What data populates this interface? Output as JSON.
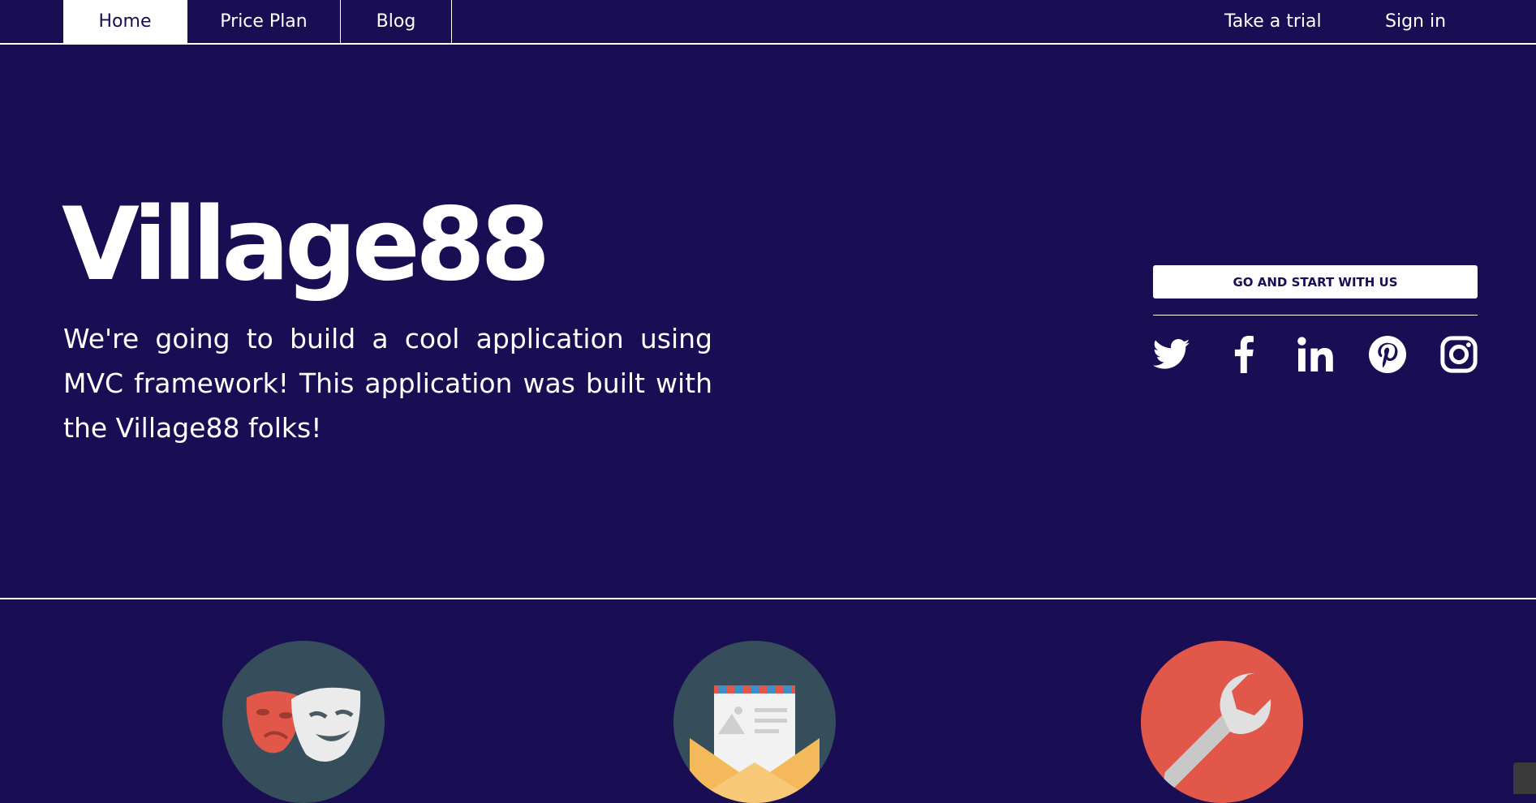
{
  "nav": {
    "items": [
      {
        "label": "Home",
        "active": true
      },
      {
        "label": "Price Plan",
        "active": false
      },
      {
        "label": "Blog",
        "active": false
      }
    ],
    "trial_label": "Take a trial",
    "signin_label": "Sign in"
  },
  "hero": {
    "title": "Village88",
    "description": "We're going to build a cool application using MVC framework! This application was built with the Village88 folks!"
  },
  "cta": {
    "label": "GO AND START WITH US"
  },
  "social": [
    "twitter-icon",
    "facebook-icon",
    "linkedin-icon",
    "pinterest-icon",
    "instagram-icon"
  ],
  "features": [
    "theater-masks-icon",
    "envelope-letter-icon",
    "wrench-icon"
  ],
  "colors": {
    "background": "#190e53",
    "text": "#ffffff",
    "feature_dark": "#364d5c",
    "feature_red": "#e1574a"
  }
}
